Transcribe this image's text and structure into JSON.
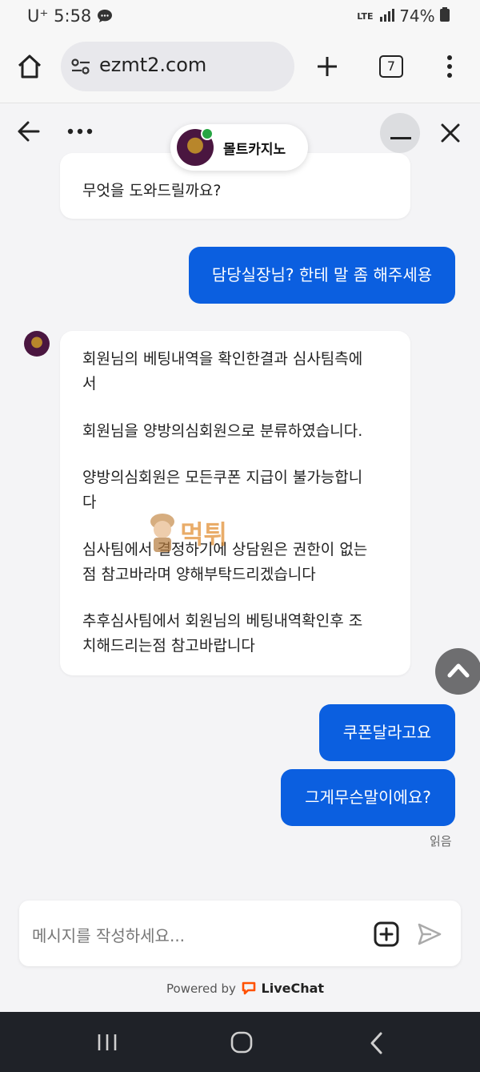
{
  "status_bar": {
    "carrier": "U⁺ 5:58",
    "network": "LTE",
    "battery": "74%"
  },
  "browser": {
    "url": "ezmt2.com",
    "tab_count": "7"
  },
  "chat": {
    "agent_name": "몰트카지노",
    "messages": [
      {
        "from": "agent",
        "lines": [
          "무엇을 도와드릴까요?"
        ]
      },
      {
        "from": "user",
        "lines": [
          "담당실장님? 한테 말 좀 해주세용"
        ]
      },
      {
        "from": "agent",
        "lines": [
          "회원님의 베팅내역을 확인한결과 심사팀측에",
          "서",
          "",
          "회원님을 양방의심회원으로 분류하였습니다.",
          "",
          "양방의심회원은 모든쿠폰 지급이 불가능합니",
          "다",
          "",
          "심사팀에서 결정하기에 상담원은 권한이 없는",
          "점 참고바라며 양해부탁드리겠습니다",
          "",
          "추후심사팀에서 회원님의 베팅내역확인후 조",
          "치해드리는점 참고바랍니다"
        ]
      },
      {
        "from": "user",
        "lines": [
          "쿠폰달라고요"
        ]
      },
      {
        "from": "user",
        "lines": [
          "그게무슨말이에요?"
        ]
      }
    ],
    "read_status": "읽음",
    "watermark": "먹튀"
  },
  "composer": {
    "placeholder": "메시지를 작성하세요..."
  },
  "footer": {
    "powered_by": "Powered by",
    "brand": "LiveChat"
  }
}
